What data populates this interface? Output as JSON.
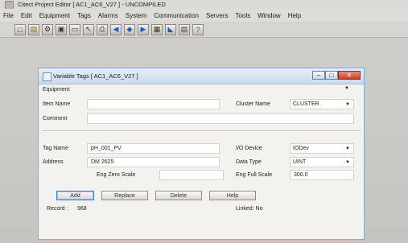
{
  "window": {
    "title": "Citect Project Editor [ AC1_AC6_V27 ] - UNCOMPILED"
  },
  "menu": [
    "File",
    "Edit",
    "Equipment",
    "Tags",
    "Alarms",
    "System",
    "Communication",
    "Servers",
    "Tools",
    "Window",
    "Help"
  ],
  "toolbar": [
    "new-icon",
    "open-icon",
    "equipment-icon",
    "tags-icon",
    "alarms-icon",
    "help-arrow-icon",
    "back-icon",
    "forward-icon",
    "save-icon",
    "copy-icon",
    "paste-icon",
    "undo-icon",
    "print-icon",
    "help-icon"
  ],
  "dialog": {
    "title": "Variable Tags [ AC1_AC6_V27 ]",
    "equipment_label": "Equipment",
    "item_name_label": "Item Name",
    "cluster_name_label": "Cluster Name",
    "cluster_name_value": "CLUSTER",
    "comment_label": "Comment",
    "tag_name_label": "Tag Name",
    "tag_name_value": "pH_001_PV",
    "address_label": "Address",
    "address_value": "DM 2625",
    "io_device_label": "I/O Device",
    "io_device_value": "IODev",
    "data_type_label": "Data Type",
    "data_type_value": "UINT",
    "eng_zero_label": "Eng Zero Scale",
    "eng_full_label": "Eng Full Scale",
    "eng_full_value": "300.0",
    "buttons": {
      "add": "Add",
      "replace": "Replace",
      "delete": "Delete",
      "help": "Help"
    },
    "record_label": "Record :",
    "record_value": "968",
    "linked_label": "Linked: No"
  },
  "colors": {
    "title_accent": "#c9d9ec",
    "close_button": "#c2442a",
    "default_button_border": "#3c7fd3"
  }
}
